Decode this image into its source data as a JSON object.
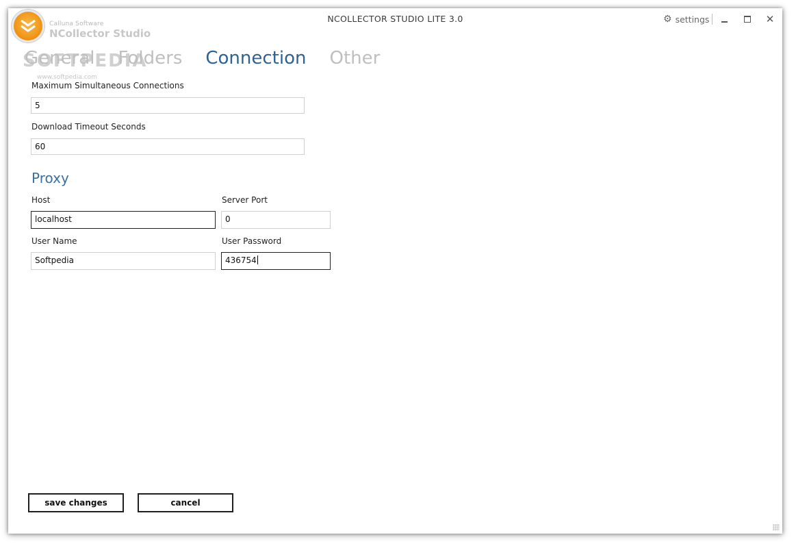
{
  "window": {
    "title": "NCOLLECTOR STUDIO LITE 3.0",
    "settings_label": "settings",
    "controls": [
      "minimize-icon",
      "maximize-icon",
      "close-icon"
    ],
    "close_glyph": "✕"
  },
  "brand": {
    "company": "Calluna Software",
    "product": "NCollector Studio",
    "accent": "#f39a1d"
  },
  "watermark": {
    "text": "SOFTPEDIA",
    "url": "www.softpedia.com"
  },
  "tabs": [
    {
      "label": "General",
      "active": false
    },
    {
      "label": "Folders",
      "active": false
    },
    {
      "label": "Connection",
      "active": true
    },
    {
      "label": "Other",
      "active": false
    }
  ],
  "connection": {
    "max_connections_label": "Maximum Simultaneous Connections",
    "max_connections_value": "5",
    "timeout_label": "Download Timeout Seconds",
    "timeout_value": "60"
  },
  "proxy": {
    "title": "Proxy",
    "host_label": "Host",
    "host_value": "localhost",
    "port_label": "Server Port",
    "port_value": "0",
    "username_label": "User Name",
    "username_value": "Softpedia",
    "password_label": "User Password",
    "password_value": "436754"
  },
  "actions": {
    "save_label": "save changes",
    "cancel_label": "cancel"
  },
  "colors": {
    "active_tab": "#2f6293",
    "inactive_tab": "#bfbfbf",
    "section_title": "#3a6fa0"
  }
}
